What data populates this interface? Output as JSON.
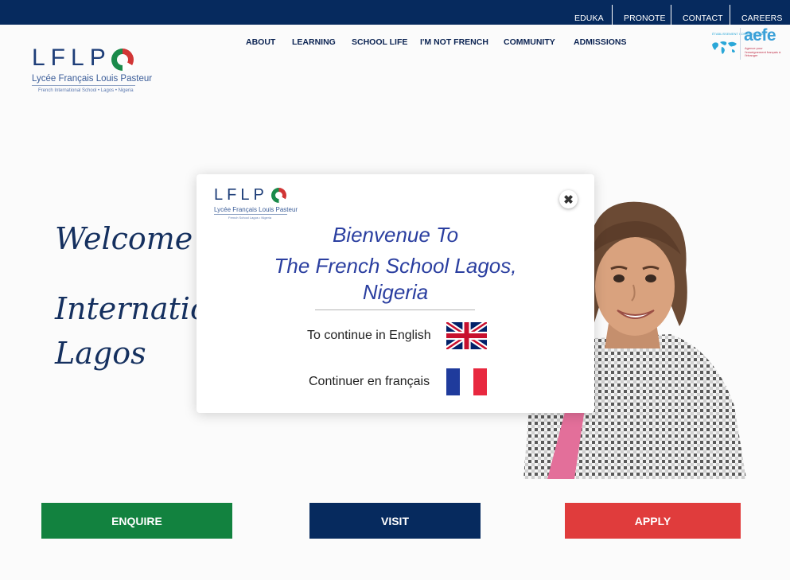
{
  "topbar": {
    "links": [
      "EDUKA",
      "PRONOTE",
      "CONTACT",
      "CAREERS"
    ]
  },
  "logo": {
    "letters": "LFLP",
    "name": "Lycée Français Louis Pasteur",
    "tagline": "French International School • Lagos • Nigeria"
  },
  "nav": {
    "items": [
      "ABOUT",
      "LEARNING",
      "SCHOOL LIFE",
      "I'M NOT FRENCH",
      "COMMUNITY",
      "ADMISSIONS"
    ]
  },
  "aefe": {
    "word": "aefe",
    "small": "ÉTABLISSEMENT CONVENTIONNÉ",
    "sub": "Agence pour l'enseignement français à l'étranger"
  },
  "hero": {
    "line1": "Welcome to",
    "line2": "International",
    "line3": "Lagos"
  },
  "cta": {
    "enquire": "ENQUIRE",
    "visit": "VISIT",
    "apply": "APPLY"
  },
  "modal": {
    "logo_letters": "LFLP",
    "logo_name": "Lycée Français Louis Pasteur",
    "logo_tagline": "French School Lagos • Nigeria",
    "title_line1": "Bienvenue To",
    "title_line2": "The French School Lagos,",
    "title_line3": "Nigeria",
    "english_label": "To continue in English",
    "french_label": "Continuer en français",
    "close_glyph": "✖"
  },
  "colors": {
    "navy": "#062a5e",
    "green": "#12823f",
    "red": "#e03c3c",
    "modal_title": "#2b3fa0"
  }
}
